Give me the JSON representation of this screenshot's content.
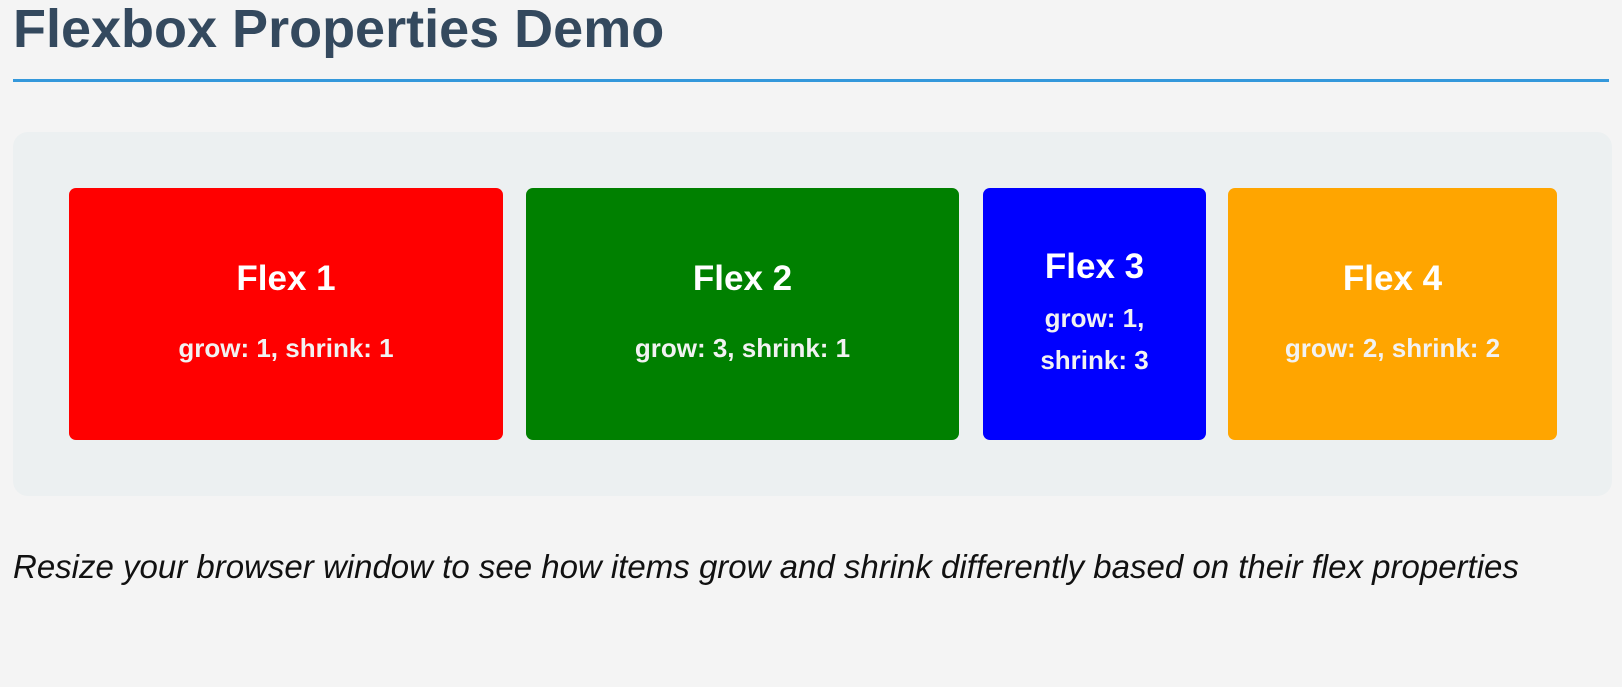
{
  "header": {
    "title": "Flexbox Properties Demo"
  },
  "flex_items": [
    {
      "title": "Flex 1",
      "description": "grow: 1, shrink: 1",
      "color": "#ff0000"
    },
    {
      "title": "Flex 2",
      "description": "grow: 3, shrink: 1",
      "color": "#008000"
    },
    {
      "title": "Flex 3",
      "description": "grow: 1, shrink: 3",
      "color": "#0000ff"
    },
    {
      "title": "Flex 4",
      "description": "grow: 2, shrink: 2",
      "color": "#ffa500"
    }
  ],
  "note": {
    "text": "Resize your browser window to see how items grow and shrink differently based on their flex properties"
  },
  "colors": {
    "title": "#34495e",
    "accent": "#3498db",
    "container_bg": "#ecf0f1",
    "page_bg": "#f4f4f4"
  }
}
